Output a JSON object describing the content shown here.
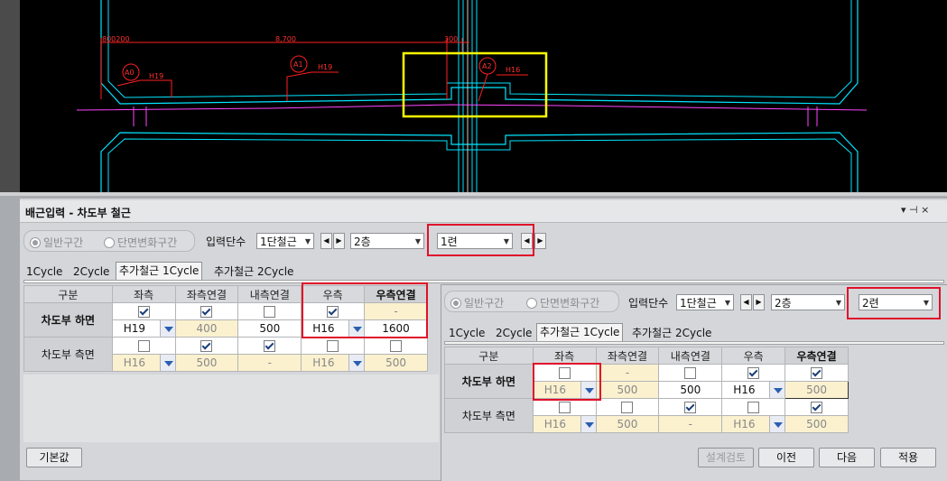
{
  "cad": {
    "dim_text_1": "800200",
    "dim_text_2": "8,700",
    "dim_text_3": "300",
    "marker_a0": "A0",
    "marker_a1": "A1",
    "marker_a2": "A2",
    "label_h19a": "H19",
    "label_h19b": "H19",
    "label_h16": "H16"
  },
  "panel": {
    "title": "배근입력 - 차도부 철근",
    "title_controls": "▾ ⊣ ×",
    "radio_normal": "일반구간",
    "radio_section": "단면변화구간",
    "input_level_label": "입력단수",
    "combo_rebar": "1단철근",
    "combo_layer": "2층",
    "combo_row": "1련",
    "tabs": [
      "1Cycle",
      "2Cycle",
      "추가철근 1Cycle",
      "추가철근 2Cycle"
    ],
    "headers": [
      "구분",
      "좌측",
      "좌측연결",
      "내측연결",
      "우측",
      "우측연결"
    ],
    "row1_label": "차도부 하면",
    "row1_dash": "-",
    "row1_left_val": "H19",
    "row1_left_conn": "400",
    "row1_inner_conn": "500",
    "row1_right_val": "H16",
    "row1_right_conn": "1600",
    "row2_label": "차도부 측면",
    "row2_left_val": "H16",
    "row2_left_conn": "500",
    "row2_inner_conn": "-",
    "row2_right_val": "H16",
    "row2_right_conn": "500",
    "default_button": "기본값"
  },
  "right": {
    "radio_normal": "일반구간",
    "radio_section": "단면변화구간",
    "input_level_label": "입력단수",
    "combo_rebar": "1단철근",
    "combo_layer": "2층",
    "combo_row": "2련",
    "tabs": [
      "1Cycle",
      "2Cycle",
      "추가철근 1Cycle",
      "추가철근 2Cycle"
    ],
    "headers": [
      "구분",
      "좌측",
      "좌측연결",
      "내측연결",
      "우측",
      "우측연결"
    ],
    "row1_label": "차도부 하면",
    "row1_dash": "-",
    "row1_left_val": "H16",
    "row1_left_conn": "500",
    "row1_inner_conn": "500",
    "row1_right_val": "H16",
    "row1_right_conn": "500",
    "row2_label": "차도부 측면",
    "row2_left_val": "H16",
    "row2_left_conn": "500",
    "row2_inner_conn": "-",
    "row2_right_val": "H16",
    "row2_right_conn": "500"
  },
  "buttons": {
    "design_check": "설계검토",
    "prev": "이전",
    "next": "다음",
    "apply": "적용"
  },
  "colors": {
    "cad_bg": "#000000",
    "highlight_red": "#e0102a",
    "highlight_yellow": "#ffff00",
    "cyan": "#00ffff",
    "magenta": "#ff44ff"
  }
}
